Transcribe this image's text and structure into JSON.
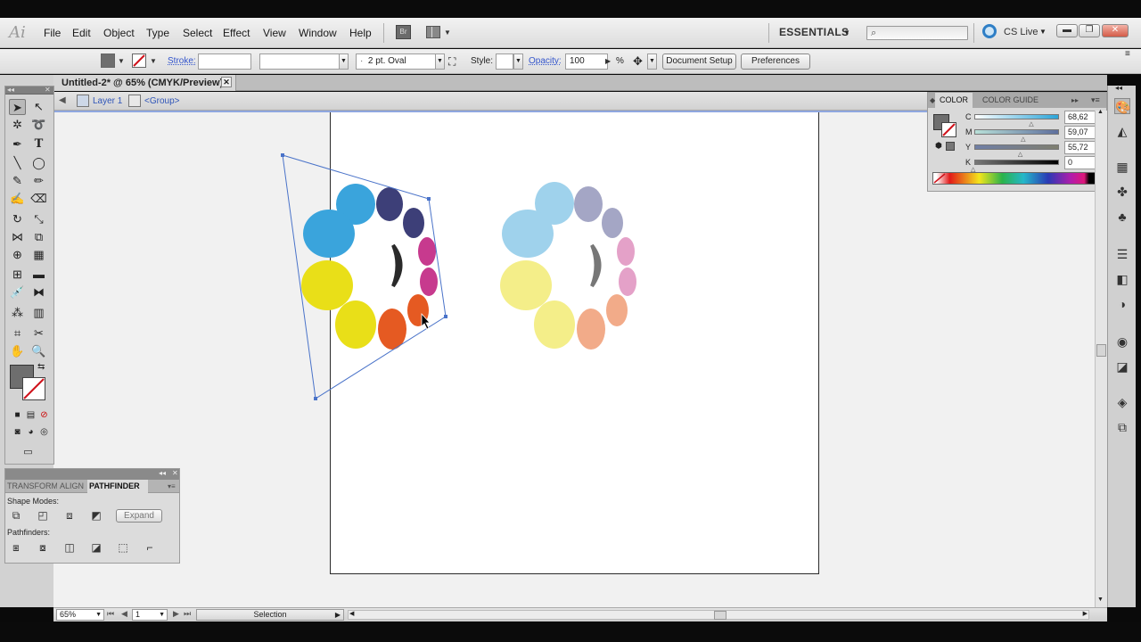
{
  "app": {
    "logo": "Ai"
  },
  "menu": [
    "File",
    "Edit",
    "Object",
    "Type",
    "Select",
    "Effect",
    "View",
    "Window",
    "Help"
  ],
  "header": {
    "bridge_label": "Br",
    "workspace": "ESSENTIALS",
    "cslive": "CS Live"
  },
  "control": {
    "stroke_label": "Stroke:",
    "brush": "2 pt. Oval",
    "style_label": "Style:",
    "opacity_label": "Opacity:",
    "opacity_value": "100",
    "opacity_unit": "%",
    "document_setup": "Document Setup",
    "preferences": "Preferences",
    "fill_color": "#6e6e6e"
  },
  "document": {
    "tab_title": "Untitled-2* @ 65% (CMYK/Preview)",
    "layer": "Layer 1",
    "group": "<Group>"
  },
  "color_panel": {
    "tab_color": "COLOR",
    "tab_guide": "COLOR GUIDE",
    "channels": [
      {
        "name": "C",
        "value": "68,62",
        "level": 0.6862,
        "gradient": "linear-gradient(90deg,#fff,#2ba5d9)"
      },
      {
        "name": "M",
        "value": "59,07",
        "level": 0.5907,
        "gradient": "linear-gradient(90deg,#b8e0d8,#5e6f9d)"
      },
      {
        "name": "Y",
        "value": "55,72",
        "level": 0.5572,
        "gradient": "linear-gradient(90deg,#6f7fa6,#7f7f70)"
      },
      {
        "name": "K",
        "value": "0",
        "level": 0,
        "gradient": "linear-gradient(90deg,#777,#000)"
      }
    ],
    "pct": "%"
  },
  "pathfinder": {
    "tabs": [
      "TRANSFORM",
      "ALIGN",
      "PATHFINDER"
    ],
    "shape_modes_label": "Shape Modes:",
    "pathfinders_label": "Pathfinders:",
    "expand": "Expand"
  },
  "status": {
    "zoom": "65%",
    "page": "1",
    "tool": "Selection"
  },
  "artwork": {
    "colors": {
      "blue": "#3aa4dc",
      "navy": "#3d3f78",
      "magenta": "#c73a8e",
      "orange": "#e55a22",
      "yellow": "#e9df18",
      "blue_light": "#9fd2ec",
      "navy_light": "#a4a6c5",
      "magenta_light": "#e4a1c8",
      "orange_light": "#f2ab89",
      "yellow_light": "#f4ee89",
      "crescent": "#2a2a2a",
      "crescent_light": "#777777",
      "selection": "#4a73c9"
    }
  }
}
